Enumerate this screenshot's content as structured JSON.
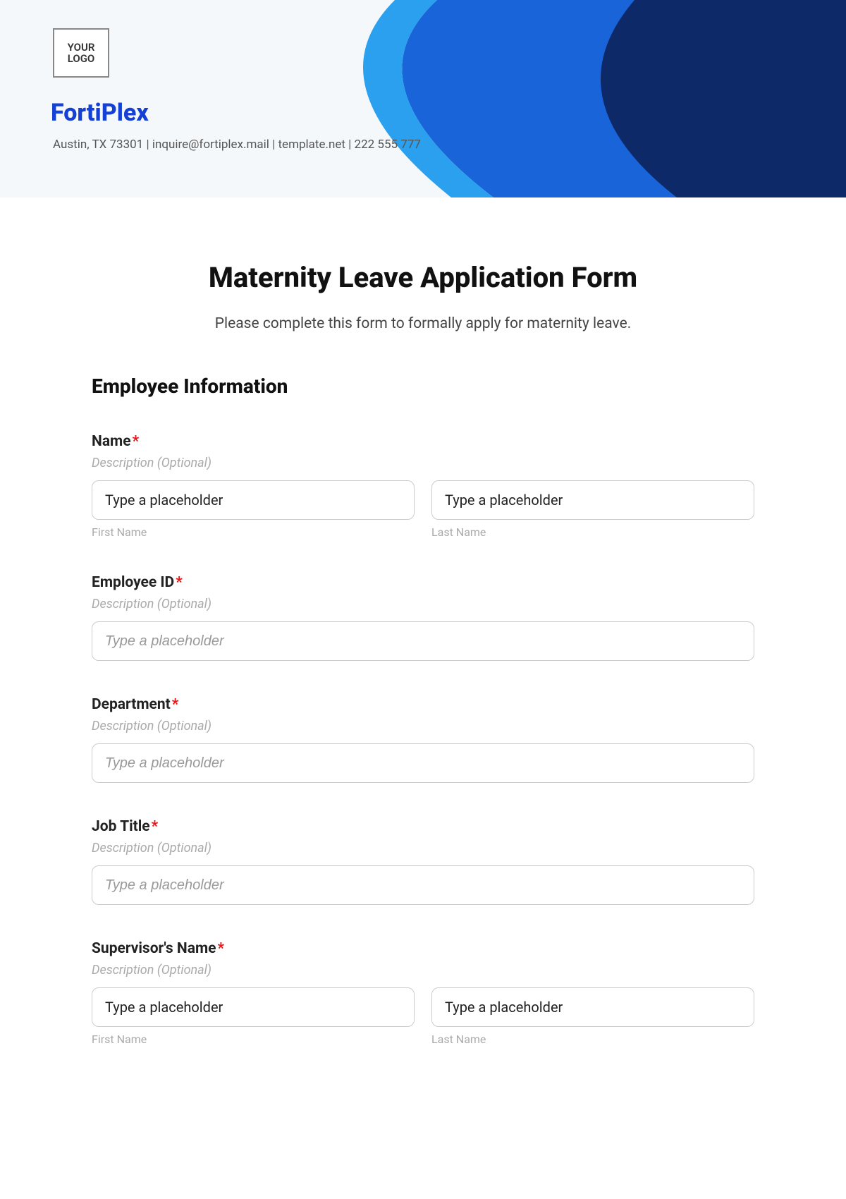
{
  "header": {
    "logo_text": "YOUR\nLOGO",
    "brand": "FortiPlex",
    "contact": "Austin, TX 73301 | inquire@fortiplex.mail | template.net | 222 555 777"
  },
  "form": {
    "title": "Maternity Leave Application Form",
    "subtitle": "Please complete this form to formally apply for maternity leave.",
    "section_heading": "Employee Information",
    "desc_placeholder": "Description (Optional)",
    "input_placeholder": "Type a placeholder",
    "sublabel_first": "First Name",
    "sublabel_last": "Last Name",
    "fields": {
      "name": {
        "label": "Name",
        "required": "*"
      },
      "employee_id": {
        "label": "Employee ID",
        "required": "*"
      },
      "department": {
        "label": "Department",
        "required": "*"
      },
      "job_title": {
        "label": "Job Title",
        "required": "*"
      },
      "supervisor": {
        "label": "Supervisor's Name",
        "required": "*"
      }
    }
  }
}
